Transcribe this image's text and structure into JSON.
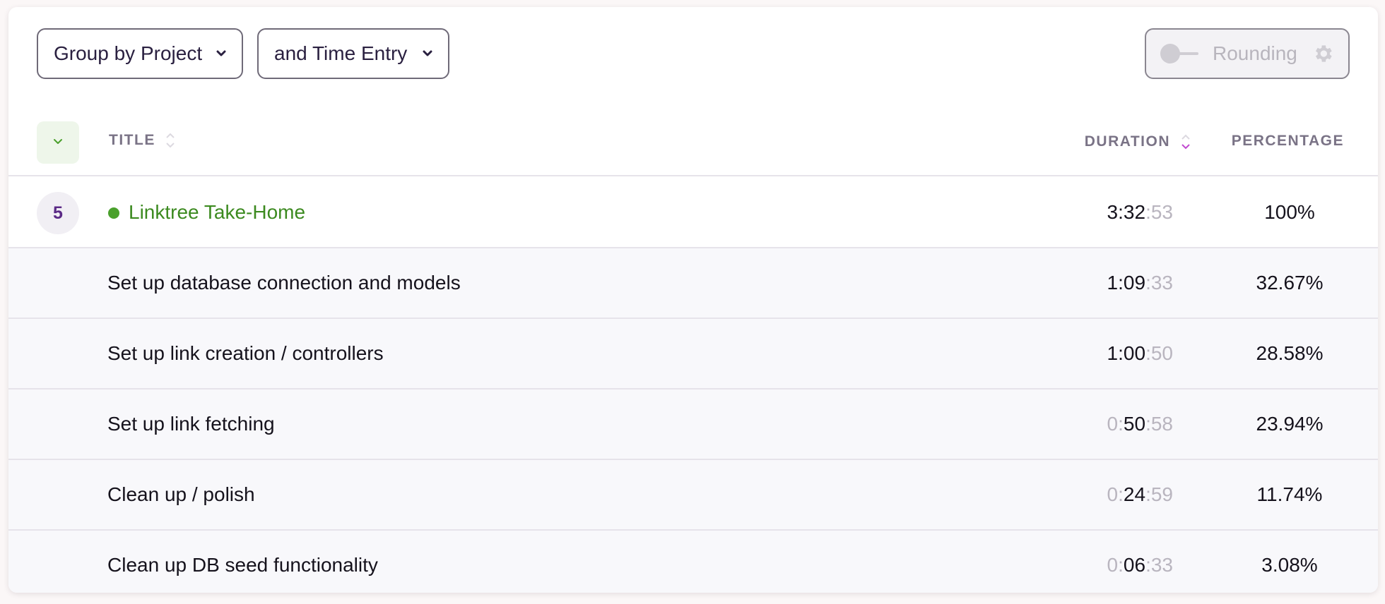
{
  "toolbar": {
    "group_by_label": "Group by Project",
    "secondary_group_label": "and Time Entry",
    "rounding_label": "Rounding",
    "rounding_enabled": false
  },
  "table": {
    "headers": {
      "title": "TITLE",
      "duration": "DURATION",
      "percentage": "PERCENTAGE"
    },
    "sort": {
      "column": "duration",
      "direction": "descending"
    },
    "group": {
      "count": "5",
      "title": "Linktree Take-Home",
      "color": "#4aa02c",
      "duration": {
        "h": "3",
        "sep1": ":",
        "m": "32",
        "sep2": ":",
        "s": "53"
      },
      "percentage": "100%"
    },
    "rows": [
      {
        "title": "Set up database connection and models",
        "duration": {
          "h": "1",
          "sep1": ":",
          "m": "09",
          "sep2": ":",
          "s": "33"
        },
        "percentage": "32.67%"
      },
      {
        "title": "Set up link creation / controllers",
        "duration": {
          "h": "1",
          "sep1": ":",
          "m": "00",
          "sep2": ":",
          "s": "50"
        },
        "percentage": "28.58%"
      },
      {
        "title": "Set up link fetching",
        "duration": {
          "h": "0",
          "sep1": ":",
          "m": "50",
          "sep2": ":",
          "s": "58"
        },
        "percentage": "23.94%"
      },
      {
        "title": "Clean up / polish",
        "duration": {
          "h": "0",
          "sep1": ":",
          "m": "24",
          "sep2": ":",
          "s": "59"
        },
        "percentage": "11.74%"
      },
      {
        "title": "Clean up DB seed functionality",
        "duration": {
          "h": "0",
          "sep1": ":",
          "m": "06",
          "sep2": ":",
          "s": "33"
        },
        "percentage": "3.08%"
      }
    ]
  },
  "colors": {
    "accent": "#3c8a20",
    "sort_active": "#c04ad0",
    "badge_text": "#5b2a86"
  },
  "icons": {
    "dropdown": "chevron-down-icon",
    "collapse": "chevron-down-icon",
    "sort": "sort-icon",
    "settings": "gear-icon",
    "project": "project-color-dot"
  }
}
